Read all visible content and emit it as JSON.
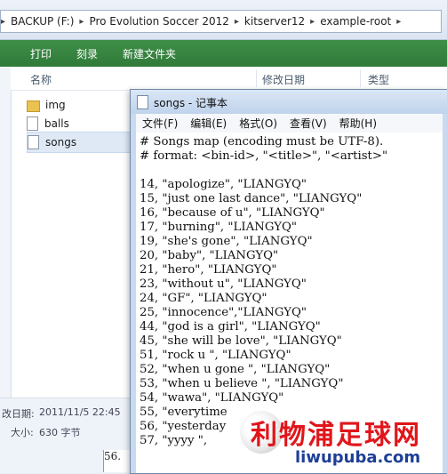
{
  "explorer": {
    "breadcrumbs": [
      "BACKUP (F:)",
      "Pro Evolution Soccer 2012",
      "kitserver12",
      "example-root"
    ],
    "toolbar": [
      "打印",
      "刻录",
      "新建文件夹"
    ],
    "columns": [
      "名称",
      "修改日期",
      "类型"
    ],
    "files": [
      {
        "name": "img",
        "icon": "folder-icon"
      },
      {
        "name": "balls",
        "icon": "file-icon"
      },
      {
        "name": "songs",
        "icon": "file-icon"
      }
    ],
    "details": {
      "modified_label": "改日期:",
      "modified_value": "2011/11/5 22:45",
      "size_label": "大小:",
      "size_value": "630 字节"
    }
  },
  "notepad": {
    "title": "songs - 记事本",
    "menu": [
      "文件(F)",
      "编辑(E)",
      "格式(O)",
      "查看(V)",
      "帮助(H)"
    ],
    "lines": [
      "# Songs map (encoding must be UTF-8).",
      "# format: <bin-id>, \"<title>\", \"<artist>\"",
      "",
      "14, \"apologize\", \"LIANGYQ\"",
      "15, \"just one last dance\", \"LIANGYQ\"",
      "16, \"because of u\", \"LIANGYQ\"",
      "17, \"burning\", \"LIANGYQ\"",
      "19, \"she's gone\", \"LIANGYQ\"",
      "20, \"baby\", \"LIANGYQ\"",
      "21, \"hero\", \"LIANGYQ\"",
      "23, \"without u\", \"LIANGYQ\"",
      "24, \"GF\", \"LIANGYQ\"",
      "25, \"innocence\",\"LIANGYQ\"",
      "44, \"god is a girl\", \"LIANGYQ\"",
      "45, \"she will be love\", \"LIANGYQ\"",
      "51, \"rock u \", \"LIANGYQ\"",
      "52, \"when u gone \", \"LIANGYQ\"",
      "53, \"when u believe \", \"LIANGYQ\"",
      "54, \"wawa\", \"LIANGYQ\"",
      "55, \"everytime",
      "56, \"yesterday",
      "57, \"yyyy \","
    ]
  },
  "behind_window": {
    "text": "56."
  },
  "watermark": {
    "line1": "利物浦足球网",
    "line2": "liwupuba.com"
  }
}
